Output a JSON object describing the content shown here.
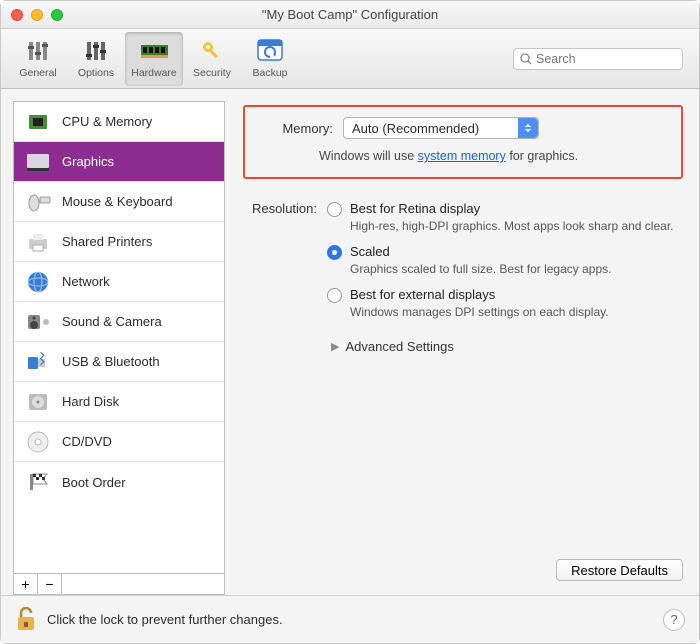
{
  "window": {
    "title": "\"My Boot Camp\" Configuration"
  },
  "search": {
    "placeholder": "Search",
    "value": ""
  },
  "toolbar": {
    "items": [
      {
        "label": "General",
        "icon": "sliders"
      },
      {
        "label": "Options",
        "icon": "sliders2"
      },
      {
        "label": "Hardware",
        "icon": "ram",
        "selected": true
      },
      {
        "label": "Security",
        "icon": "key"
      },
      {
        "label": "Backup",
        "icon": "refresh"
      }
    ]
  },
  "sidebar": {
    "items": [
      {
        "label": "CPU & Memory",
        "icon": "cpu"
      },
      {
        "label": "Graphics",
        "icon": "gpu",
        "selected": true
      },
      {
        "label": "Mouse & Keyboard",
        "icon": "mouse"
      },
      {
        "label": "Shared Printers",
        "icon": "printer"
      },
      {
        "label": "Network",
        "icon": "globe"
      },
      {
        "label": "Sound & Camera",
        "icon": "speaker"
      },
      {
        "label": "USB & Bluetooth",
        "icon": "usb"
      },
      {
        "label": "Hard Disk",
        "icon": "hdd"
      },
      {
        "label": "CD/DVD",
        "icon": "disc"
      },
      {
        "label": "Boot Order",
        "icon": "flag"
      }
    ],
    "add": "+",
    "remove": "−"
  },
  "detail": {
    "memory": {
      "label": "Memory:",
      "value": "Auto (Recommended)",
      "desc_pre": "Windows will use ",
      "desc_link": "system memory",
      "desc_post": " for graphics."
    },
    "resolution": {
      "label": "Resolution:",
      "options": [
        {
          "title": "Best for Retina display",
          "desc": "High-res, high-DPI graphics. Most apps look sharp and clear.",
          "checked": false
        },
        {
          "title": "Scaled",
          "desc": "Graphics scaled to full size. Best for legacy apps.",
          "checked": true
        },
        {
          "title": "Best for external displays",
          "desc": "Windows manages DPI settings on each display.",
          "checked": false
        }
      ],
      "advanced": "Advanced Settings"
    },
    "restore": "Restore Defaults"
  },
  "footer": {
    "lock_text": "Click the lock to prevent further changes.",
    "help": "?"
  }
}
